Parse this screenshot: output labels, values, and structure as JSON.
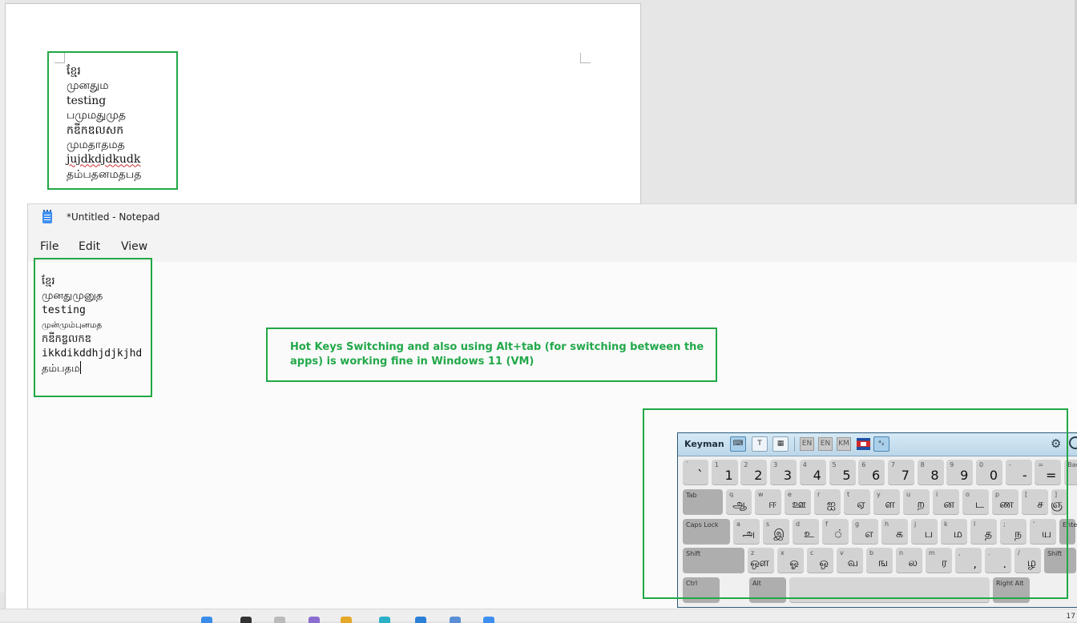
{
  "word_doc": {
    "lines": [
      "ខ្មែរ",
      "முனதும",
      "testing",
      "பமுமதுமுத",
      "កឌីកឌលសក",
      "முமதாதமத",
      "jujdkdjdkudk",
      "தம்பதனமதபத"
    ]
  },
  "notepad": {
    "title": "*Untitled - Notepad",
    "menu": {
      "file": "File",
      "edit": "Edit",
      "view": "View"
    },
    "lines": [
      "ខ្មែរ",
      "முனதுமுனுத",
      "testing",
      "முன்மும்புனமத",
      "កឌីកឌ្លលកឌ",
      "ikkdikddhjdjkjhd",
      "தம்பதம"
    ]
  },
  "annotation": {
    "text": "Hot Keys Switching and also using Alt+tab (for switching between the apps) is working fine in Windows 11 (VM)",
    "color": "#22a84a"
  },
  "keyman": {
    "brand": "Keyman",
    "langs": [
      "EN",
      "EN",
      "KM"
    ],
    "tools": [
      "keyboard-icon",
      "text-icon",
      "character-map-icon",
      "osk-icon"
    ],
    "rows": [
      [
        {
          "up": "`",
          "main": "`"
        },
        {
          "up": "1",
          "main": "1"
        },
        {
          "up": "2",
          "main": "2"
        },
        {
          "up": "3",
          "main": "3"
        },
        {
          "up": "4",
          "main": "4"
        },
        {
          "up": "5",
          "main": "5"
        },
        {
          "up": "6",
          "main": "6"
        },
        {
          "up": "7",
          "main": "7"
        },
        {
          "up": "8",
          "main": "8"
        },
        {
          "up": "9",
          "main": "9"
        },
        {
          "up": "0",
          "main": "0"
        },
        {
          "up": "-",
          "main": "-"
        },
        {
          "up": "=",
          "main": "="
        },
        {
          "up": "Back",
          "main": ""
        }
      ],
      [
        {
          "lbl": "Tab"
        },
        {
          "up": "q",
          "main": "ஆ"
        },
        {
          "up": "w",
          "main": "ஈ"
        },
        {
          "up": "e",
          "main": "ஊ"
        },
        {
          "up": "r",
          "main": "ஐ"
        },
        {
          "up": "t",
          "main": "ஏ"
        },
        {
          "up": "y",
          "main": "ள"
        },
        {
          "up": "u",
          "main": "ற"
        },
        {
          "up": "i",
          "main": "ன"
        },
        {
          "up": "o",
          "main": "ட"
        },
        {
          "up": "p",
          "main": "ண"
        },
        {
          "up": "[",
          "main": "ச"
        },
        {
          "up": "]",
          "main": "ஞ"
        }
      ],
      [
        {
          "lbl": "Caps Lock"
        },
        {
          "up": "a",
          "main": "அ"
        },
        {
          "up": "s",
          "main": "இ"
        },
        {
          "up": "d",
          "main": "உ"
        },
        {
          "up": "f",
          "main": "் "
        },
        {
          "up": "g",
          "main": "எ"
        },
        {
          "up": "h",
          "main": "க"
        },
        {
          "up": "j",
          "main": "ப"
        },
        {
          "up": "k",
          "main": "ம"
        },
        {
          "up": "l",
          "main": "த"
        },
        {
          "up": ";",
          "main": "ந"
        },
        {
          "up": "'",
          "main": "ய"
        },
        {
          "lbl": "Enter"
        }
      ],
      [
        {
          "lbl": "Shift"
        },
        {
          "up": "z",
          "main": "ஔ"
        },
        {
          "up": "x",
          "main": "ஓ"
        },
        {
          "up": "c",
          "main": "ஒ"
        },
        {
          "up": "v",
          "main": "வ"
        },
        {
          "up": "b",
          "main": "ங"
        },
        {
          "up": "n",
          "main": "ல"
        },
        {
          "up": "m",
          "main": "ர"
        },
        {
          "up": ",",
          "main": ","
        },
        {
          "up": ".",
          "main": "."
        },
        {
          "up": "/",
          "main": "ழ"
        },
        {
          "lbl": "Shift"
        }
      ],
      [
        {
          "lbl": "Ctrl"
        },
        {
          "lbl": "Alt"
        },
        {
          "lbl": ""
        },
        {
          "lbl": "Right Alt"
        }
      ]
    ]
  },
  "taskbar": {
    "clock": "17"
  }
}
